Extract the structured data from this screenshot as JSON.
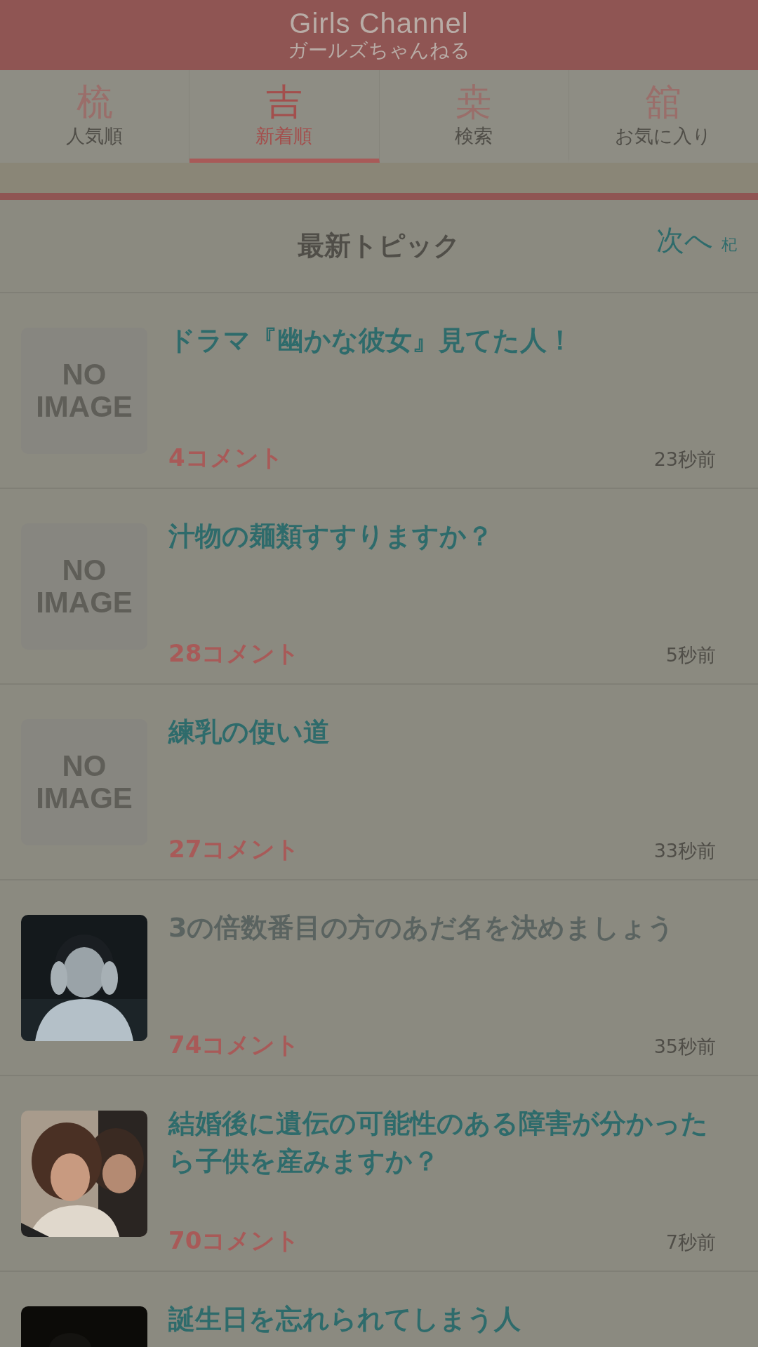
{
  "header": {
    "logo": "Girls Channel",
    "subtitle": "ガールズちゃんねる"
  },
  "tabs": [
    {
      "glyph": "梳",
      "label": "人気順",
      "selected": false
    },
    {
      "glyph": "吉",
      "label": "新着順",
      "selected": true
    },
    {
      "glyph": "桒",
      "label": "検索",
      "selected": false
    },
    {
      "glyph": "舘",
      "label": "お気に入り",
      "selected": false
    }
  ],
  "section": {
    "title": "最新トピック",
    "next_label": "次へ",
    "next_glyph": "杞"
  },
  "topics": [
    {
      "kind": "placeholder",
      "image_text": [
        "NO",
        "IMAGE"
      ],
      "title": "ドラマ『幽かな彼女』見てた人！",
      "read": false,
      "comments": "4コメント",
      "time": "23秒前"
    },
    {
      "kind": "placeholder",
      "image_text": [
        "NO",
        "IMAGE"
      ],
      "title": "汁物の麺類すすりますか？",
      "read": false,
      "comments": "28コメント",
      "time": "5秒前"
    },
    {
      "kind": "placeholder",
      "image_text": [
        "NO",
        "IMAGE"
      ],
      "title": "練乳の使い道",
      "read": false,
      "comments": "27コメント",
      "time": "33秒前"
    },
    {
      "kind": "picture",
      "title": "3の倍数番目の方のあだ名を決めましょう",
      "read": true,
      "comments": "74コメント",
      "time": "35秒前"
    },
    {
      "kind": "picture",
      "title": "結婚後に遺伝の可能性のある障害が分かったら子供を産みますか？",
      "read": false,
      "comments": "70コメント",
      "time": "7秒前"
    },
    {
      "kind": "picture",
      "title": "誕生日を忘れられてしまう人",
      "read": false
    }
  ]
}
